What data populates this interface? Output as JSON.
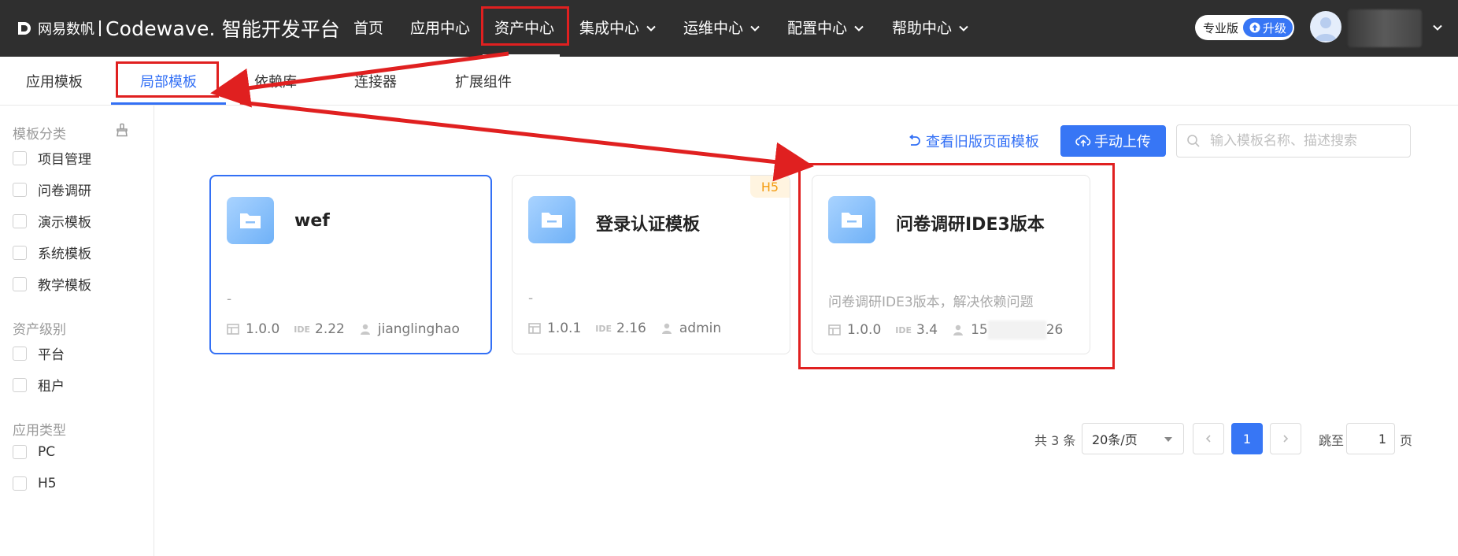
{
  "brand": {
    "logo_cn": "网易数帆",
    "product": "Codewave.",
    "platform": "智能开发平台"
  },
  "topnav": {
    "items": [
      {
        "label": "首页",
        "dropdown": false
      },
      {
        "label": "应用中心",
        "dropdown": false
      },
      {
        "label": "资产中心",
        "dropdown": false,
        "active": true
      },
      {
        "label": "集成中心",
        "dropdown": true
      },
      {
        "label": "运维中心",
        "dropdown": true
      },
      {
        "label": "配置中心",
        "dropdown": true
      },
      {
        "label": "帮助中心",
        "dropdown": true
      }
    ],
    "edition": "专业版",
    "upgrade": "升级"
  },
  "subtabs": [
    {
      "label": "应用模板"
    },
    {
      "label": "局部模板",
      "active": true
    },
    {
      "label": "依赖库"
    },
    {
      "label": "连接器"
    },
    {
      "label": "扩展组件"
    }
  ],
  "sidebar": {
    "groups": [
      {
        "title": "模板分类",
        "options": [
          "项目管理",
          "问卷调研",
          "演示模板",
          "系统模板",
          "教学模板"
        ]
      },
      {
        "title": "资产级别",
        "options": [
          "平台",
          "租户"
        ]
      },
      {
        "title": "应用类型",
        "options": [
          "PC",
          "H5"
        ]
      }
    ]
  },
  "toolbar": {
    "old_link": "查看旧版页面模板",
    "upload": "手动上传",
    "search_placeholder": "输入模板名称、描述搜索"
  },
  "cards": [
    {
      "title": "wef",
      "desc": "-",
      "version": "1.0.0",
      "ide_label": "IDE",
      "ide": "2.22",
      "author": "jianglinghao",
      "badge": ""
    },
    {
      "title": "登录认证模板",
      "desc": "-",
      "version": "1.0.1",
      "ide_label": "IDE",
      "ide": "2.16",
      "author": "admin",
      "badge": "H5"
    },
    {
      "title": "问卷调研IDE3版本",
      "desc": "问卷调研IDE3版本，解决依赖问题",
      "version": "1.0.0",
      "ide_label": "IDE",
      "ide": "3.4",
      "author_prefix": "15",
      "author_suffix": "26",
      "badge": ""
    }
  ],
  "pagination": {
    "total": "共 3 条",
    "page_size": "20条/页",
    "current": "1",
    "jump_label": "跳至",
    "jump_value": "1",
    "page_unit": "页"
  },
  "colors": {
    "accent": "#3370f5",
    "topbar": "#2f2f2f",
    "annotation": "#e02020"
  }
}
